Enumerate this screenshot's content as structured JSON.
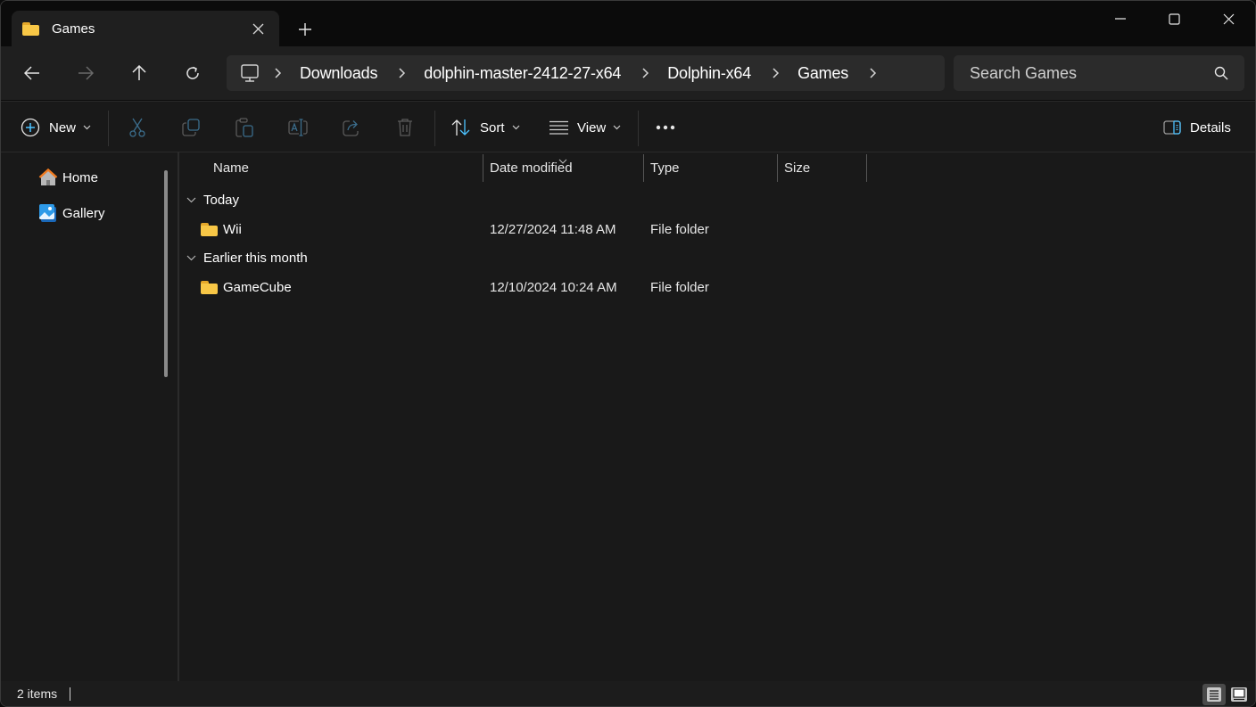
{
  "window": {
    "tab_title": "Games",
    "tab_icon": "folder-icon",
    "new_tab_symbol": "+",
    "close_tab_symbol": "✕",
    "controls": {
      "minimize": "minimize-icon",
      "maximize": "maximize-icon",
      "close": "close-icon"
    }
  },
  "nav": {
    "back": "back-arrow-icon",
    "forward": "forward-arrow-icon",
    "up": "up-arrow-icon",
    "refresh": "refresh-icon",
    "breadcrumb": [
      "Downloads",
      "dolphin-master-2412-27-x64",
      "Dolphin-x64",
      "Games"
    ],
    "search_placeholder": "Search Games"
  },
  "commandbar": {
    "new_label": "New",
    "icons": [
      "cut-icon",
      "copy-icon",
      "paste-icon",
      "rename-icon",
      "share-icon",
      "delete-icon"
    ],
    "sort_label": "Sort",
    "view_label": "View",
    "more_symbol": "•••",
    "details_label": "Details"
  },
  "sidebar": {
    "items": [
      {
        "label": "Home",
        "icon": "home-icon"
      },
      {
        "label": "Gallery",
        "icon": "gallery-icon"
      }
    ]
  },
  "columns": {
    "name": "Name",
    "date": "Date modified",
    "type": "Type",
    "size": "Size",
    "sorted_by": "Date modified"
  },
  "groups": [
    {
      "label": "Today",
      "items": [
        {
          "name": "Wii",
          "date": "12/27/2024 11:48 AM",
          "type": "File folder",
          "size": ""
        }
      ]
    },
    {
      "label": "Earlier this month",
      "items": [
        {
          "name": "GameCube",
          "date": "12/10/2024 10:24 AM",
          "type": "File folder",
          "size": ""
        }
      ]
    }
  ],
  "status": {
    "item_count": "2 items"
  },
  "colors": {
    "accent": "#4cc2ff",
    "folder": "#f8c746",
    "background": "#191919",
    "chrome": "#1f1f1f",
    "titlebar": "#0b0b0b"
  }
}
